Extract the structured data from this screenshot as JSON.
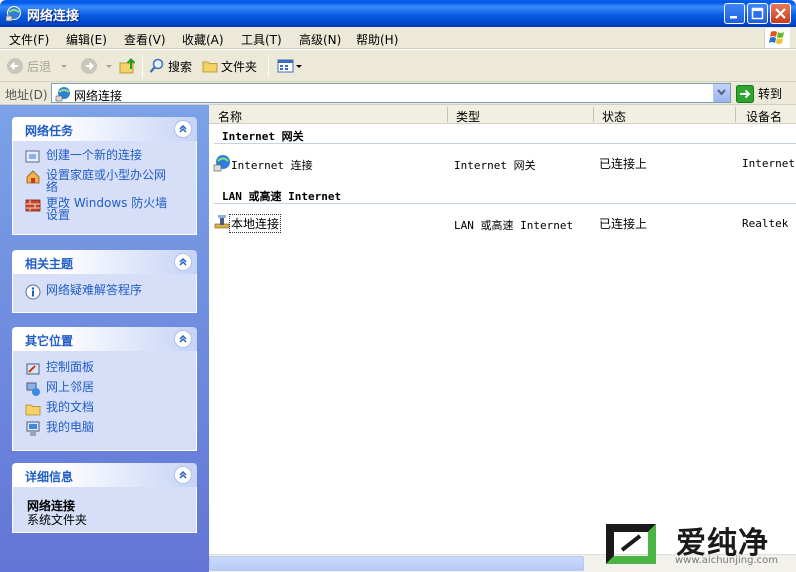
{
  "window": {
    "title": "网络连接",
    "colors": {
      "titlebar": "#0058ee",
      "close": "#c53c1c",
      "pane_link": "#215dc6"
    }
  },
  "menu": {
    "items": [
      "文件(F)",
      "编辑(E)",
      "查看(V)",
      "收藏(A)",
      "工具(T)",
      "高级(N)",
      "帮助(H)"
    ]
  },
  "toolbar": {
    "back_label": "后退",
    "search_label": "搜索",
    "folders_label": "文件夹"
  },
  "address": {
    "label": "地址(D)",
    "value": "网络连接",
    "go_label": "转到"
  },
  "taskpane": {
    "network_tasks": {
      "title": "网络任务",
      "items": [
        "创建一个新的连接",
        "设置家庭或小型办公网络",
        "更改 Windows 防火墙设置"
      ]
    },
    "related": {
      "title": "相关主题",
      "items": [
        "网络疑难解答程序"
      ]
    },
    "other_places": {
      "title": "其它位置",
      "items": [
        "控制面板",
        "网上邻居",
        "我的文档",
        "我的电脑"
      ]
    },
    "details": {
      "title": "详细信息",
      "name": "网络连接",
      "type": "系统文件夹"
    }
  },
  "content": {
    "columns": [
      "名称",
      "类型",
      "状态",
      "设备名"
    ],
    "groups": [
      {
        "title": "Internet 网关",
        "rows": [
          {
            "name": "Internet 连接",
            "type": "Internet 网关",
            "status": "已连接上",
            "device": "Internet"
          }
        ]
      },
      {
        "title": "LAN 或高速 Internet",
        "rows": [
          {
            "name": "本地连接",
            "type": "LAN 或高速 Internet",
            "status": "已连接上",
            "device": "Realtek"
          }
        ]
      }
    ]
  },
  "watermark": {
    "brand": "爱纯净",
    "url": "www.aichunjing.com"
  }
}
